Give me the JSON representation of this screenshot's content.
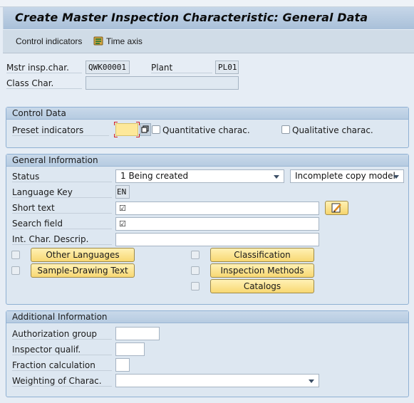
{
  "window": {
    "title": "Create Master Inspection Characteristic: General Data"
  },
  "toolbar": {
    "control_indicators": "Control indicators",
    "time_axis": "Time axis"
  },
  "header": {
    "mstr_label": "Mstr insp.char.",
    "mstr_value": "QWK00001",
    "plant_label": "Plant",
    "plant_value": "PL01",
    "class_label": "Class Char.",
    "class_value": ""
  },
  "control_data": {
    "title": "Control Data",
    "preset_label": "Preset indicators",
    "preset_value": "",
    "quantitative_label": "Quantitative charac.",
    "quantitative_checked": false,
    "qualitative_label": "Qualitative charac.",
    "qualitative_checked": false
  },
  "general_info": {
    "title": "General Information",
    "status_label": "Status",
    "status_value": "1 Being created",
    "copy_model_value": "Incomplete copy model",
    "language_label": "Language Key",
    "language_value": "EN",
    "short_text_label": "Short text",
    "short_text_value": "☑",
    "search_field_label": "Search field",
    "search_field_value": "☑",
    "int_char_label": "Int. Char. Descrip.",
    "int_char_value": "",
    "buttons": {
      "other_languages": "Other Languages",
      "sample_drawing": "Sample-Drawing Text",
      "classification": "Classification",
      "inspection_methods": "Inspection Methods",
      "catalogs": "Catalogs"
    }
  },
  "additional_info": {
    "title": "Additional Information",
    "auth_label": "Authorization group",
    "auth_value": "",
    "inspector_label": "Inspector qualif.",
    "inspector_value": "",
    "fraction_label": "Fraction calculation",
    "fraction_value": "",
    "weighting_label": "Weighting of Charac.",
    "weighting_value": ""
  },
  "colors": {
    "button_yellow": "#f8d873",
    "required_marker": "#d62020",
    "group_border": "#8fb0d3"
  }
}
